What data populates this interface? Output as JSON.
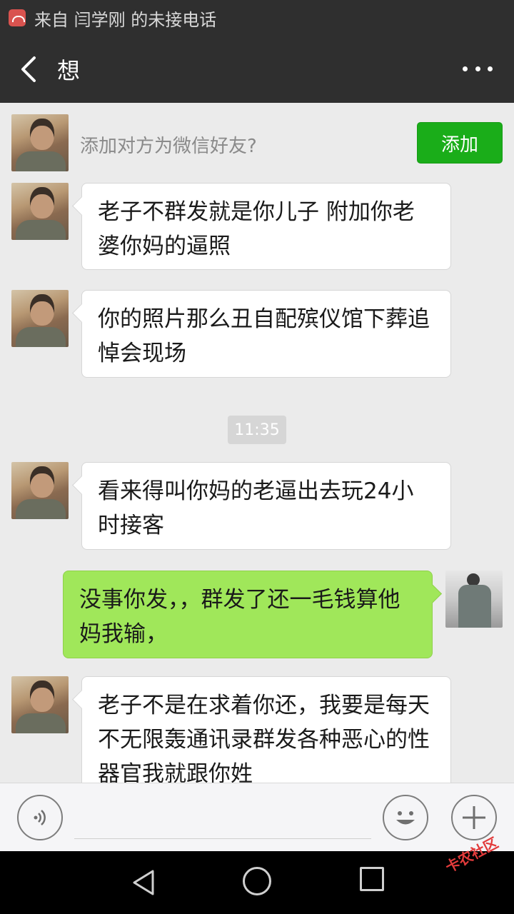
{
  "status_bar": {
    "notification_text": "来自 闫学刚 的未接电话"
  },
  "header": {
    "title": "想"
  },
  "add_friend": {
    "prompt": "添加对方为微信好友?",
    "button_label": "添加"
  },
  "messages": [
    {
      "from": "other",
      "text": "老子不群发就是你儿子 附加你老婆你妈的逼照"
    },
    {
      "from": "other",
      "text": "你的照片那么丑自配殡仪馆下葬追悼会现场"
    },
    {
      "from": "other",
      "text": " 看来得叫你妈的老逼出去玩24小时接客"
    },
    {
      "from": "self",
      "text": "没事你发，，群发了还一毛钱算他妈我输，"
    },
    {
      "from": "other",
      "text": "老子不是在求着你还，我要是每天不无限轰通讯录群发各种恶心的性器官我就跟你姓"
    }
  ],
  "timestamp": "11:35",
  "input": {
    "placeholder": ""
  },
  "watermark": "卡农社区",
  "colors": {
    "accent_green": "#1aad19",
    "self_bubble": "#a0e75a",
    "header_bg": "#2f2f2f"
  }
}
